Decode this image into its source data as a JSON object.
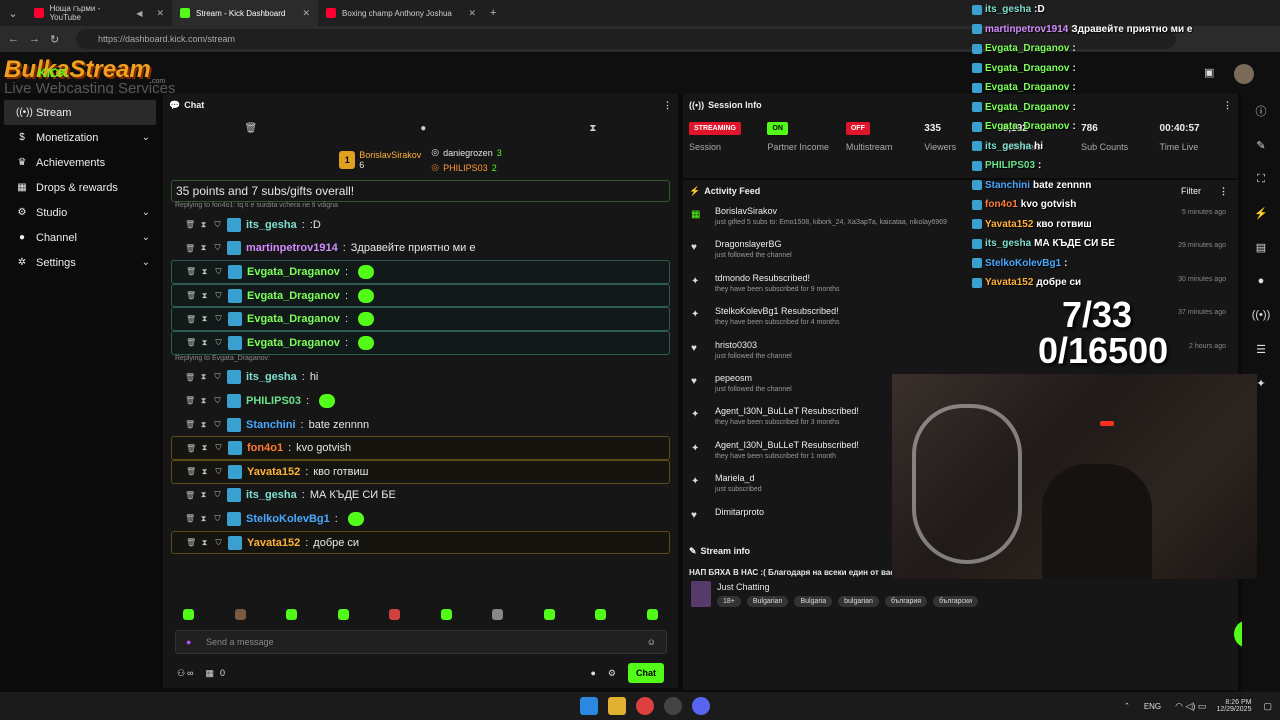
{
  "browser": {
    "tabs": [
      {
        "label": "Ноща гърми - YouTube",
        "color": "#ff0033"
      },
      {
        "label": "Stream - Kick Dashboard",
        "color": "#53fc18"
      },
      {
        "label": "Boxing champ Anthony Joshua",
        "color": "#ff0033"
      }
    ],
    "url": "https://dashboard.kick.com/stream"
  },
  "logo": {
    "main": "BulkaStream",
    "kick": "KICK",
    "sub": "Live Webcasting Services",
    "dotcom": ".com"
  },
  "sidebar": {
    "items": [
      {
        "label": "Stream",
        "icon": "stream-icon"
      },
      {
        "label": "Monetization",
        "icon": "dollar-icon"
      },
      {
        "label": "Achievements",
        "icon": "trophy-icon"
      },
      {
        "label": "Drops & rewards",
        "icon": "gift-icon"
      },
      {
        "label": "Studio",
        "icon": "gear-icon"
      },
      {
        "label": "Channel",
        "icon": "person-icon"
      },
      {
        "label": "Settings",
        "icon": "cog-icon"
      }
    ]
  },
  "chat": {
    "title": "Chat",
    "leaderboard": [
      {
        "name": "BorislavSirakov",
        "count": "6"
      },
      {
        "name": "daniegrozen",
        "count": "3"
      },
      {
        "name": "PHILIPS03",
        "count": "2"
      }
    ],
    "first_message": "35 points and 7 subs/gifts overall!",
    "reply1": "Replying to fon4o1: tq ti e surdita vchera ne ti vdigna",
    "reply2": "Replying to Evgata_Draganov:",
    "messages": [
      {
        "user": "its_gesha",
        "text": ":D",
        "color": "#7fe0d0",
        "style": ""
      },
      {
        "user": "martinpetrov1914",
        "text": "Здравейте приятно ми е",
        "color": "#d38cff",
        "style": ""
      },
      {
        "user": "Evgata_Draganov",
        "text": "",
        "color": "#7dff5a",
        "style": "hl",
        "emote": true
      },
      {
        "user": "Evgata_Draganov",
        "text": "",
        "color": "#7dff5a",
        "style": "hl",
        "emote": true
      },
      {
        "user": "Evgata_Draganov",
        "text": "",
        "color": "#7dff5a",
        "style": "hl",
        "emote": true
      },
      {
        "user": "Evgata_Draganov",
        "text": "",
        "color": "#7dff5a",
        "style": "hl",
        "emote": true
      },
      {
        "user": "its_gesha",
        "text": "hi",
        "color": "#7fe0d0",
        "style": ""
      },
      {
        "user": "PHILIPS03",
        "text": "",
        "color": "#6be08a",
        "style": "",
        "emote": true
      },
      {
        "user": "Stanchini",
        "text": "bate zennnn",
        "color": "#4aa8ff",
        "style": ""
      },
      {
        "user": "fon4o1",
        "text": "kvo gotvish",
        "color": "#ff7a3c",
        "style": "gold"
      },
      {
        "user": "Yavata152",
        "text": "кво готвиш",
        "color": "#ffb13c",
        "style": "gold"
      },
      {
        "user": "its_gesha",
        "text": "МА КЪДЕ СИ БЕ",
        "color": "#7fe0d0",
        "style": ""
      },
      {
        "user": "StelkoKolevBg1",
        "text": "",
        "color": "#4aa8ff",
        "style": "",
        "emote": true
      },
      {
        "user": "Yavata152",
        "text": "добре си",
        "color": "#ffb13c",
        "style": "gold"
      }
    ],
    "placeholder": "Send a message",
    "infinity": "∞",
    "count": "0",
    "chat_button": "Chat"
  },
  "session": {
    "title": "Session Info",
    "stats": [
      {
        "label": "Session",
        "value": "STREAMING",
        "pill": "#e0142a"
      },
      {
        "label": "Partner Income",
        "value": "ON",
        "pill": "#53fc18"
      },
      {
        "label": "Multistream",
        "value": "OFF",
        "pill": "#e0142a"
      },
      {
        "label": "Viewers",
        "value": "335"
      },
      {
        "label": "Followers",
        "value": "8,192"
      },
      {
        "label": "Sub Counts",
        "value": "786"
      },
      {
        "label": "Time Live",
        "value": "00:40:57"
      }
    ]
  },
  "activity": {
    "title": "Activity Feed",
    "filter": "Filter",
    "items": [
      {
        "name": "BorislavSirakov",
        "sub": "just gifted 5 subs to: Emo1508, kibork_24, ХаЗарТа, kaicataa, nikolay6969",
        "time": "5 minutes ago",
        "icon": "gift-icon"
      },
      {
        "name": "DragonslayerBG",
        "sub": "just followed the channel",
        "time": "29 minutes ago",
        "icon": "heart-icon"
      },
      {
        "name": "tdmondo Resubscribed!",
        "sub": "they have been subscribed for 9 months",
        "time": "30 minutes ago",
        "icon": "star-icon"
      },
      {
        "name": "StelkoKolevBg1 Resubscribed!",
        "sub": "they have been subscribed for 4 months",
        "time": "37 minutes ago",
        "icon": "star-icon"
      },
      {
        "name": "hristo0303",
        "sub": "just followed the channel",
        "time": "2 hours ago",
        "icon": "heart-icon"
      },
      {
        "name": "pepeosm",
        "sub": "just followed the channel",
        "time": "",
        "icon": "heart-icon"
      },
      {
        "name": "Agent_I30N_BuLLeT Resubscribed!",
        "sub": "they have been subscribed for 3 months",
        "time": "",
        "icon": "star-icon"
      },
      {
        "name": "Agent_I30N_BuLLeT Resubscribed!",
        "sub": "they have been subscribed for 1 month",
        "time": "",
        "icon": "star-icon"
      },
      {
        "name": "Mariela_d",
        "sub": "just subscribed",
        "time": "",
        "icon": "star-icon"
      },
      {
        "name": "Dimitarproto",
        "sub": "",
        "time": "",
        "icon": "heart-icon"
      }
    ]
  },
  "stream_info": {
    "title": "Stream info",
    "stream_title": "НАП БЯХА В НАС :( Благодаря на всеки един от вас за ежедневната подкрепа <3",
    "category": "Just Chatting",
    "tags": [
      "18+",
      "Bulgarian",
      "Bulgaria",
      "bulgarian",
      "българия",
      "български"
    ]
  },
  "overlay": {
    "lines": [
      {
        "user": "its_gesha",
        "text": ":D",
        "color": "#7fe0d0"
      },
      {
        "user": "martinpetrov1914",
        "text": "Здравейте приятно ми е",
        "color": "#d38cff"
      },
      {
        "user": "Evgata_Draganov",
        "text": ":",
        "color": "#7dff5a"
      },
      {
        "user": "Evgata_Draganov",
        "text": ":",
        "color": "#7dff5a"
      },
      {
        "user": "Evgata_Draganov",
        "text": ":",
        "color": "#7dff5a"
      },
      {
        "user": "Evgata_Draganov",
        "text": ":",
        "color": "#7dff5a"
      },
      {
        "user": "Evgata_Draganov",
        "text": ":",
        "color": "#7dff5a"
      },
      {
        "user": "its_gesha",
        "text": "hi",
        "color": "#7fe0d0"
      },
      {
        "user": "PHILIPS03",
        "text": ":",
        "color": "#6be08a"
      },
      {
        "user": "Stanchini",
        "text": "bate zennnn",
        "color": "#4aa8ff"
      },
      {
        "user": "fon4o1",
        "text": "kvo gotvish",
        "color": "#ff7a3c"
      },
      {
        "user": "Yavata152",
        "text": "кво готвиш",
        "color": "#ffb13c"
      },
      {
        "user": "its_gesha",
        "text": "МА КЪДЕ СИ БЕ",
        "color": "#7fe0d0"
      },
      {
        "user": "StelkoKolevBg1",
        "text": ":",
        "color": "#4aa8ff"
      },
      {
        "user": "Yavata152",
        "text": "добре си",
        "color": "#ffb13c"
      }
    ],
    "goal1": "7/33",
    "goal2": "0/16500"
  },
  "taskbar": {
    "lang": "ENG",
    "time": "8:26 PM",
    "date": "12/29/2025"
  }
}
